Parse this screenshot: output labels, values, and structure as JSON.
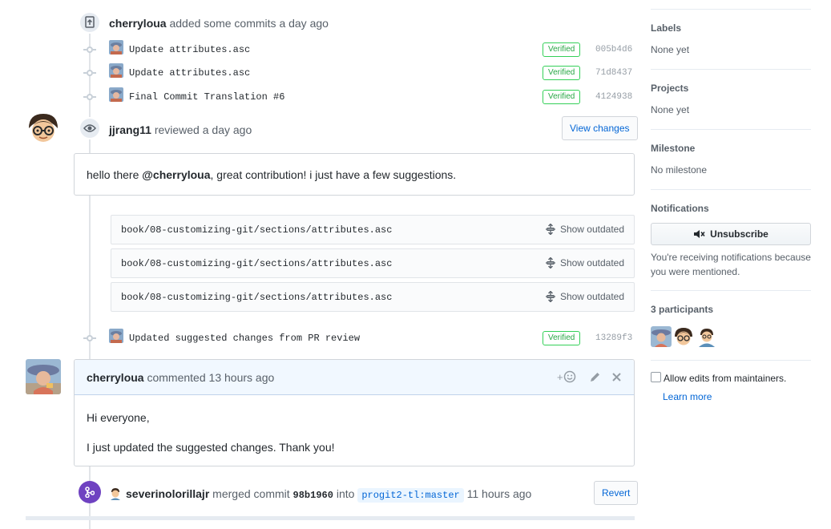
{
  "commits_event": {
    "actor": "cherryloua",
    "action": "added some commits",
    "time": "a day ago",
    "commits": [
      {
        "message": "Update attributes.asc",
        "badge": "Verified",
        "sha": "005b4d6"
      },
      {
        "message": "Update attributes.asc",
        "badge": "Verified",
        "sha": "71d8437"
      },
      {
        "message": "Final Commit Translation #6",
        "badge": "Verified",
        "sha": "4124938"
      }
    ]
  },
  "review": {
    "actor": "jjrang11",
    "action": "reviewed",
    "time": "a day ago",
    "view_changes_label": "View changes",
    "body_prefix": "hello there ",
    "mention": "@cherryloua",
    "body_suffix": ", great contribution! i just have a few suggestions.",
    "files": [
      {
        "path": "book/08-customizing-git/sections/attributes.asc",
        "action": "Show outdated"
      },
      {
        "path": "book/08-customizing-git/sections/attributes.asc",
        "action": "Show outdated"
      },
      {
        "path": "book/08-customizing-git/sections/attributes.asc",
        "action": "Show outdated"
      }
    ]
  },
  "updated_commit": {
    "message": "Updated suggested changes from PR review",
    "badge": "Verified",
    "sha": "13289f3"
  },
  "comment": {
    "actor": "cherryloua",
    "action": "commented",
    "time": "13 hours ago",
    "reaction_label": "+",
    "lines": [
      "Hi everyone,",
      "I just updated the suggested changes. Thank you!"
    ]
  },
  "merge": {
    "actor": "severinolorillajr",
    "action": "merged commit",
    "sha": "98b1960",
    "into": "into",
    "branch": "progit2-tl:master",
    "time": "11 hours ago",
    "revert_label": "Revert"
  },
  "sidebar": {
    "labels_title": "Labels",
    "labels_value": "None yet",
    "projects_title": "Projects",
    "projects_value": "None yet",
    "milestone_title": "Milestone",
    "milestone_value": "No milestone",
    "notifications_title": "Notifications",
    "unsubscribe_label": "Unsubscribe",
    "notification_reason": "You're receiving notifications because you were mentioned.",
    "participants_title": "3 participants",
    "allow_edits_label": "Allow edits from maintainers.",
    "learn_more": "Learn more"
  },
  "colors": {
    "link": "#0366d6",
    "verified": "#28a745",
    "merge_badge": "#6f42c1",
    "muted": "#586069"
  }
}
